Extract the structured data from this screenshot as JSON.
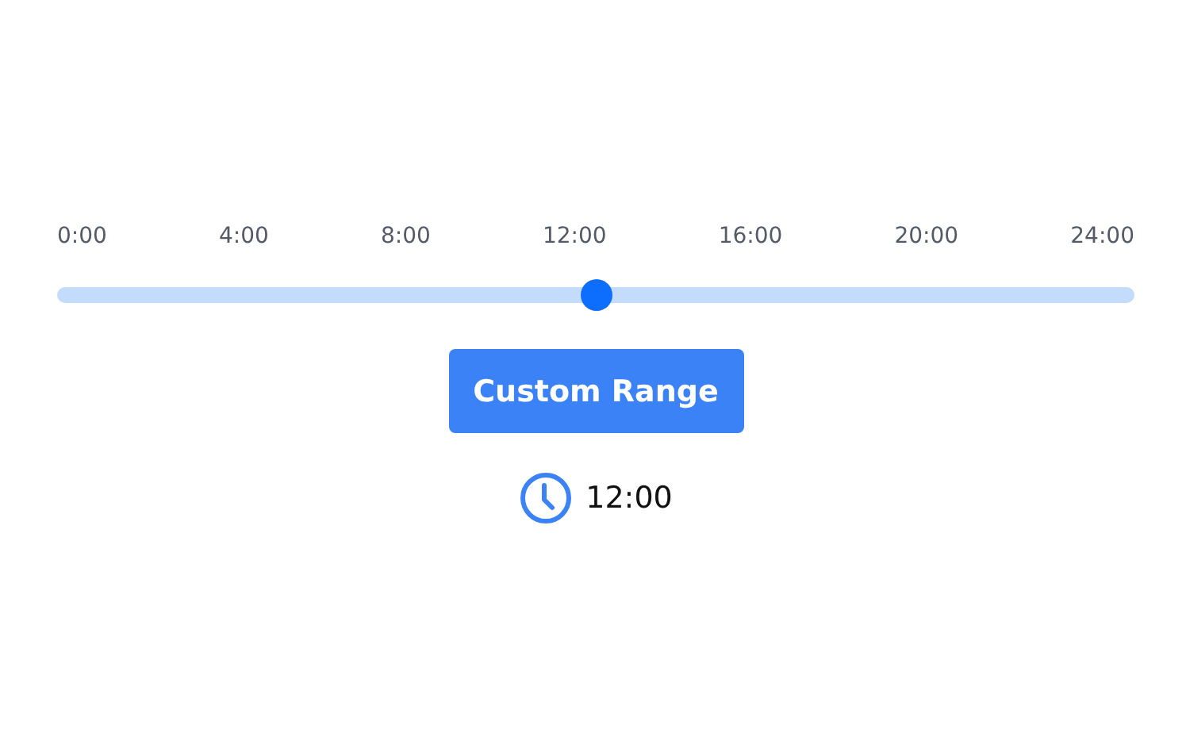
{
  "ticks": [
    "0:00",
    "4:00",
    "8:00",
    "12:00",
    "16:00",
    "20:00",
    "24:00"
  ],
  "slider": {
    "level": 0.5
  },
  "button": {
    "label": "Custom Range"
  },
  "time": {
    "value": "12:00"
  }
}
